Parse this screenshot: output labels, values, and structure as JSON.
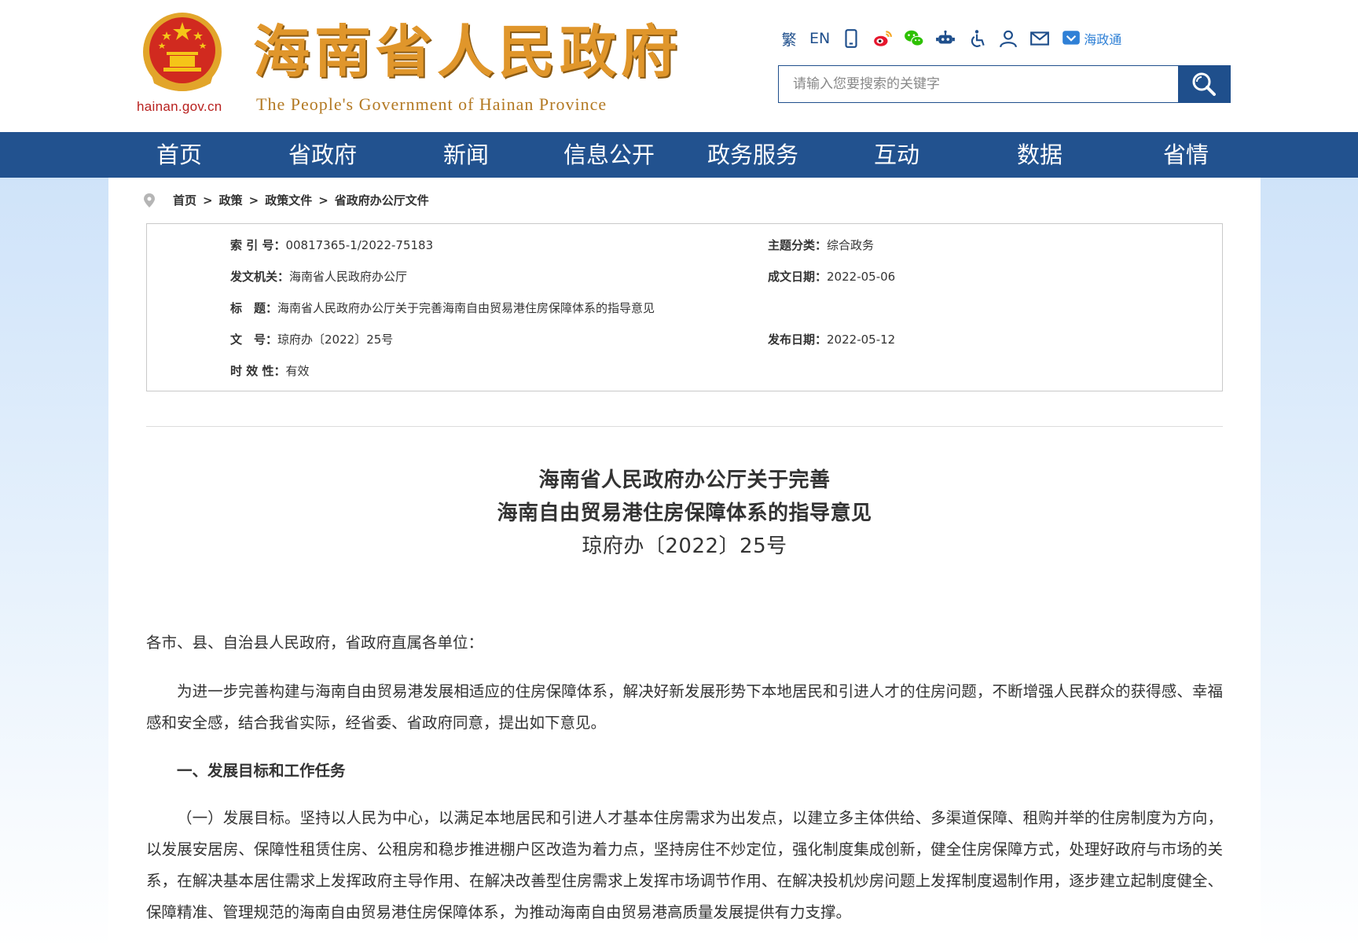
{
  "header": {
    "domain": "hainan.gov.cn",
    "title": "海南省人民政府",
    "subtitle": "The People's Government  of Hainan Province",
    "toolbar": {
      "traditional": "繁",
      "english": "EN",
      "app_label": "海政通"
    },
    "search": {
      "placeholder": "请输入您要搜索的关键字"
    }
  },
  "nav": {
    "items": [
      "首页",
      "省政府",
      "新闻",
      "信息公开",
      "政务服务",
      "互动",
      "数据",
      "省情"
    ]
  },
  "breadcrumb": [
    "首页",
    "政策",
    "政策文件",
    "省政府办公厅文件"
  ],
  "breadcrumb_sep": ">",
  "info": {
    "index_no_label": "索 引 号：",
    "index_no": "00817365-1/2022-75183",
    "topic_label": "主题分类：",
    "topic": "综合政务",
    "issuer_label": "发文机关：",
    "issuer": "海南省人民政府办公厅",
    "date_written_label": "成文日期：",
    "date_written": "2022-05-06",
    "title_label": "标　题：",
    "title": "海南省人民政府办公厅关于完善海南自由贸易港住房保障体系的指导意见",
    "doc_no_label": "文　号：",
    "doc_no": "琼府办〔2022〕25号",
    "pub_date_label": "发布日期：",
    "pub_date": "2022-05-12",
    "validity_label": "时 效 性：",
    "validity": "有效"
  },
  "document": {
    "title_line1": "海南省人民政府办公厅关于完善",
    "title_line2": "海南自由贸易港住房保障体系的指导意见",
    "doc_number": "琼府办〔2022〕25号",
    "salutation": "各市、县、自治县人民政府，省政府直属各单位：",
    "intro": "为进一步完善构建与海南自由贸易港发展相适应的住房保障体系，解决好新发展形势下本地居民和引进人才的住房问题，不断增强人民群众的获得感、幸福感和安全感，结合我省实际，经省委、省政府同意，提出如下意见。",
    "section1_heading": "一、发展目标和工作任务",
    "section1_para": "（一）发展目标。坚持以人民为中心，以满足本地居民和引进人才基本住房需求为出发点，以建立多主体供给、多渠道保障、租购并举的住房制度为方向，以发展安居房、保障性租赁住房、公租房和稳步推进棚户区改造为着力点，坚持房住不炒定位，强化制度集成创新，健全住房保障方式，处理好政府与市场的关系，在解决基本居住需求上发挥政府主导作用、在解决改善型住房需求上发挥市场调节作用、在解决投机炒房问题上发挥制度遏制作用，逐步建立起制度健全、保障精准、管理规范的海南自由贸易港住房保障体系，为推动海南自由贸易港高质量发展提供有力支撑。"
  },
  "colors": {
    "nav_bg": "#22528f",
    "title_gold": "#e0962b",
    "emblem_red": "#d12a1f"
  }
}
